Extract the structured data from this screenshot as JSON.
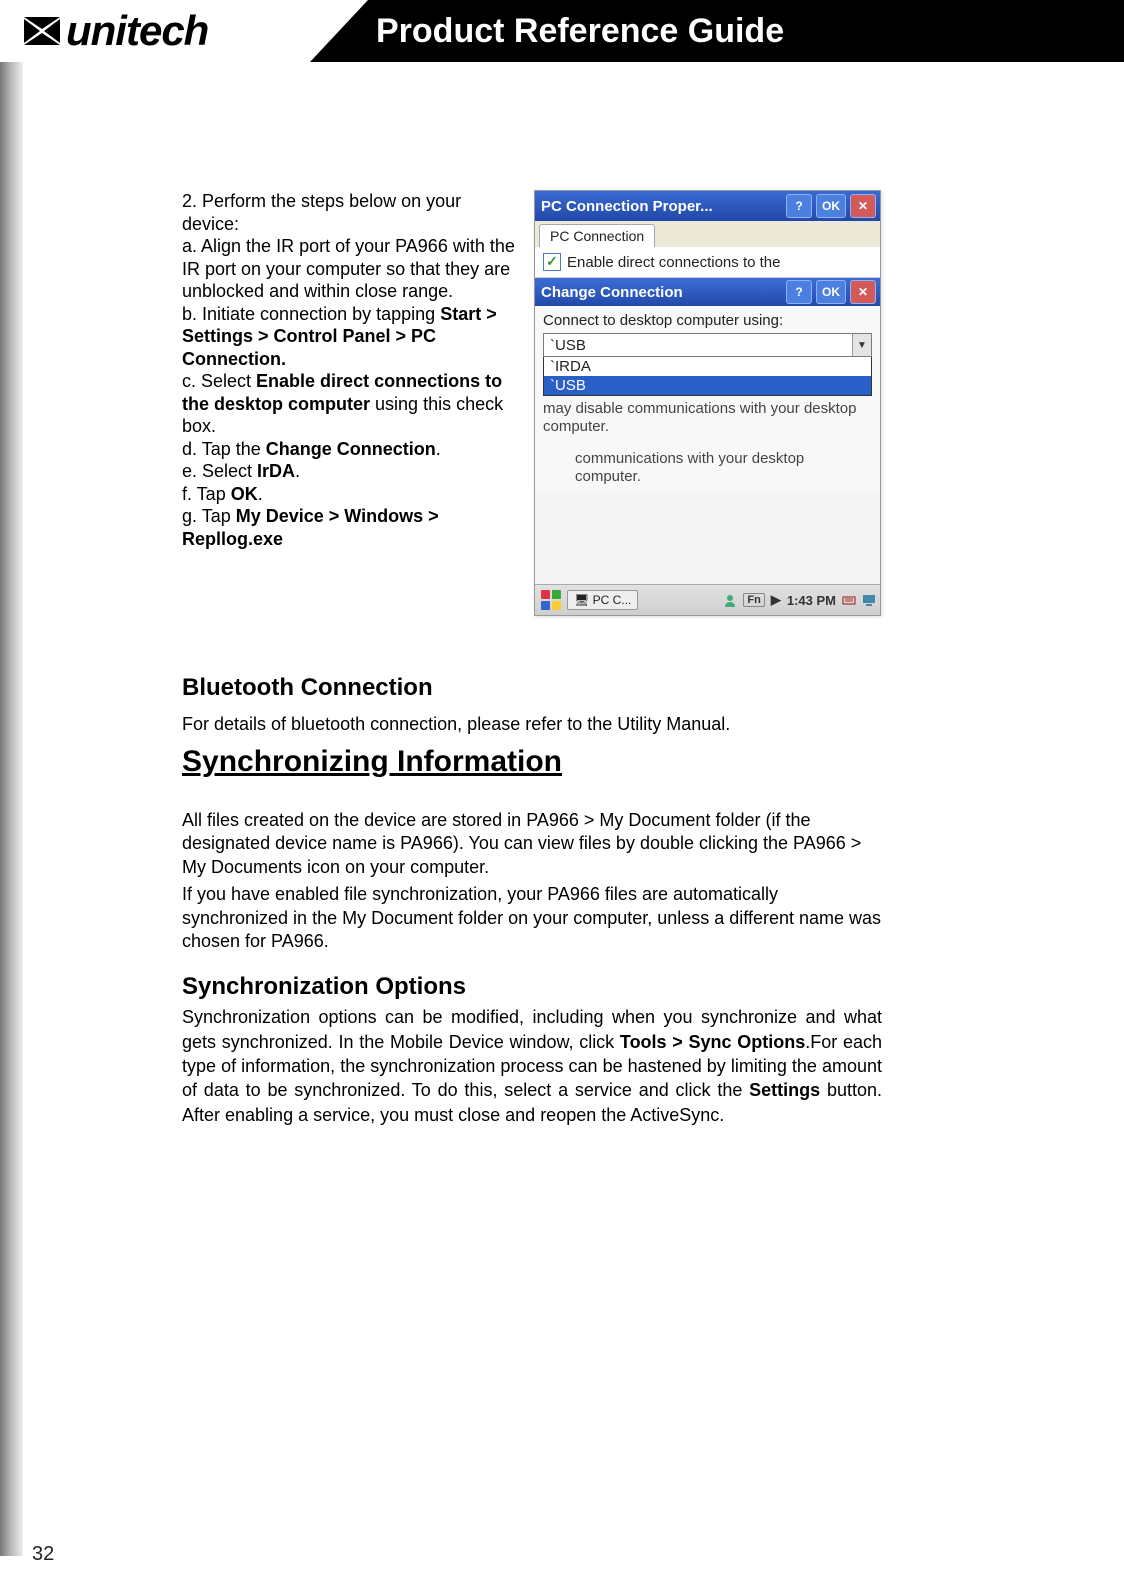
{
  "header": {
    "logo_text": "unitech",
    "title": "Product Reference Guide"
  },
  "instructions": {
    "line_2": "2. Perform the steps below on your device:",
    "line_a": "a. Align the IR port of your PA966 with the IR port on your computer so that they are unblocked and within close range.",
    "line_b_pre": "b. Initiate connection by tapping ",
    "line_b_bold": "Start > Settings > Control Panel > PC Connection.",
    "line_c_pre": "c. Select ",
    "line_c_bold": "Enable direct connections to the desktop computer",
    "line_c_post": " using this check box.",
    "line_d_pre": "d. Tap the ",
    "line_d_bold": "Change Connection",
    "line_d_post": ".",
    "line_e_pre": "e. Select ",
    "line_e_bold": "IrDA",
    "line_e_post": ".",
    "line_f_pre": "f. Tap ",
    "line_f_bold": "OK",
    "line_f_post": ".",
    "line_g_pre": "g. Tap ",
    "line_g_bold": "My Device > Windows > Repllog.exe"
  },
  "screenshot": {
    "parent_title": "PC Connection Proper...",
    "help_label": "?",
    "ok_label": "OK",
    "close_label": "✕",
    "tab_label": "PC Connection",
    "checkbox_label": "Enable direct connections to the",
    "checkbox_checked": true,
    "child_title": "Change Connection",
    "child_help": "?",
    "child_ok": "OK",
    "child_close": "✕",
    "connect_label": "Connect to desktop computer using:",
    "combo_value": "`USB",
    "combo_options": [
      "`IRDA",
      "`USB"
    ],
    "hint1": "may disable communications with your desktop computer.",
    "hint2": "communications with your desktop computer.",
    "taskbar": {
      "task1": "PC C...",
      "fn_label": "Fn",
      "time": "1:43 PM"
    }
  },
  "bluetooth": {
    "heading": "Bluetooth  Connection",
    "text": "For details of bluetooth connection, please refer to the Utility Manual."
  },
  "sync": {
    "heading": "Synchronizing Information",
    "p1": "All files created on the device are stored in PA966 > My Document folder (if the designated device name is PA966). You can view files by double clicking the PA966 > My Documents icon on your computer.",
    "p2": "If you have enabled file synchronization, your PA966 files are automatically synchronized in the My Document folder on your computer, unless a different name was chosen for PA966."
  },
  "sync_options": {
    "heading": "Synchronization Options",
    "body_pre": "Synchronization options can be modified, including when you synchronize and what gets synchronized. In the Mobile Device window, click ",
    "body_bold1": "Tools > Sync Options",
    "body_mid": ".For each type of information, the synchronization process can be hastened by limiting the amount of data to be synchronized. To do this, select a service and click the ",
    "body_bold2": "Settings",
    "body_post": " button. After enabling a service, you must close and reopen the ActiveSync."
  },
  "page_number": "32"
}
